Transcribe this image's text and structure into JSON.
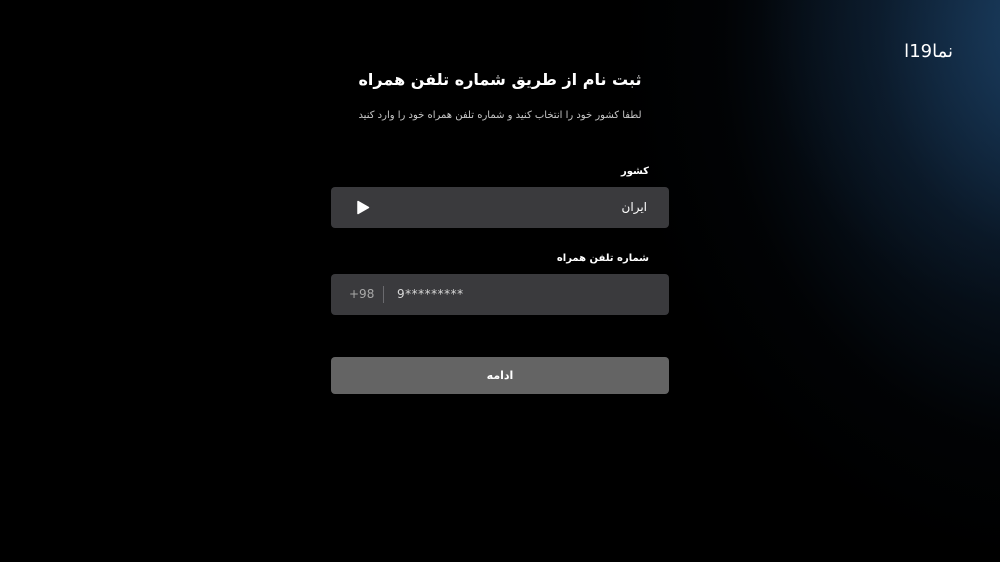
{
  "brand": {
    "logo_text": "نما۱۹ا"
  },
  "header": {
    "title": "ثبت نام از طریق شماره تلفن همراه",
    "subtitle": "لطفا کشور خود را انتخاب کنید و شماره تلفن همراه خود را وارد کنید"
  },
  "form": {
    "country": {
      "label": "کشور",
      "selected": "ایران",
      "icon": "play-icon"
    },
    "phone": {
      "label": "شماره تلفن همراه",
      "prefix": "+98",
      "value": "",
      "placeholder": "9*********"
    },
    "continue_label": "ادامه"
  },
  "colors": {
    "background": "#000000",
    "field_bg": "#3a3a3d",
    "button_bg": "#646464",
    "accent_glow": "#1e466e"
  }
}
